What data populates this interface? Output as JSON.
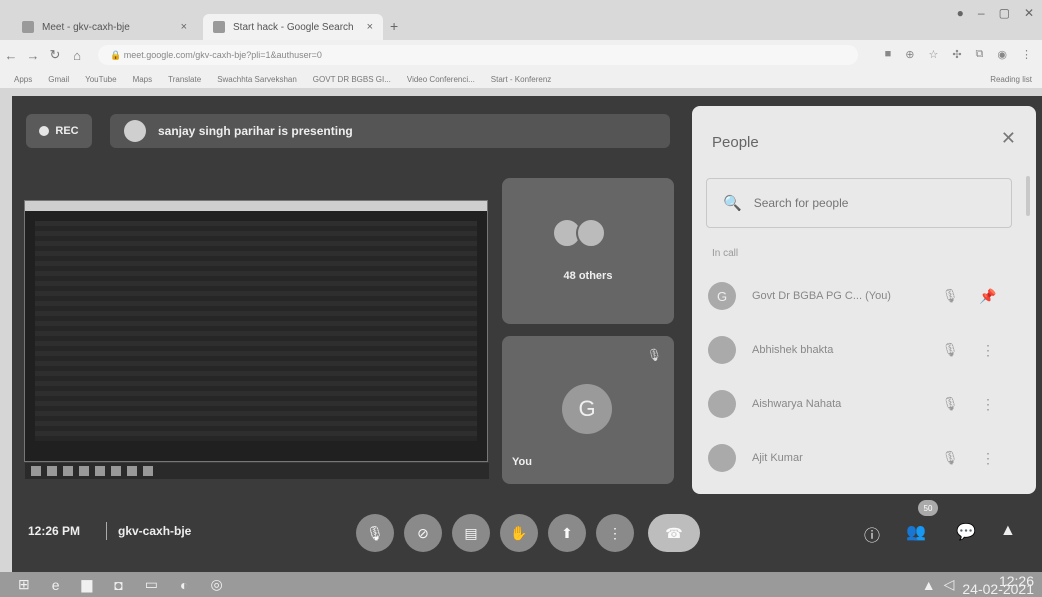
{
  "browser": {
    "tab1": "Meet - gkv-caxh-bje",
    "tab2": "Start hack - Google Search",
    "new_tab": "+",
    "url": "meet.google.com/gkv-caxh-bje?pli=1&authuser=0",
    "bookmarks": [
      "Apps",
      "Gmail",
      "YouTube",
      "Maps",
      "Translate",
      "Swachhta Sarvekshan",
      "GOVT DR BGBS GI...",
      "Video Conferenci...",
      "Start - Konferenz"
    ],
    "reading_list": "Reading list"
  },
  "meet": {
    "rec": "REC",
    "presenting": "sanjay singh parihar is presenting",
    "others_label": "48 others",
    "you_initial": "G",
    "you_label": "You",
    "time": "12:26 PM",
    "meeting_code": "gkv-caxh-bje",
    "participants_badge": "50"
  },
  "people": {
    "title": "People",
    "search_placeholder": "Search for people",
    "section": "In call",
    "list": [
      {
        "initial": "G",
        "name": "Govt Dr BGBA PG C... (You)"
      },
      {
        "initial": "",
        "name": "Abhishek bhakta"
      },
      {
        "initial": "",
        "name": "Aishwarya Nahata"
      },
      {
        "initial": "",
        "name": "Ajit Kumar"
      }
    ]
  },
  "taskbar": {
    "clock_time": "12:26",
    "clock_date": "24-02-2021"
  },
  "colors": {
    "meet_bg": "#3b3b3b",
    "panel_bg": "#e9e9e9",
    "tile_bg": "#666666"
  }
}
